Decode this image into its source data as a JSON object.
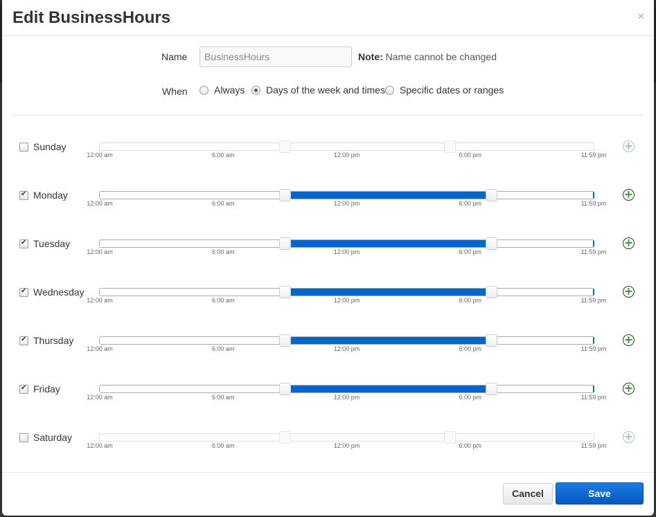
{
  "dialog": {
    "title": "Edit BusinessHours",
    "close_glyph": "×"
  },
  "name_field": {
    "label": "Name",
    "value": "BusinessHours",
    "note_label": "Note:",
    "note_text": "Name cannot be changed"
  },
  "when": {
    "label": "When",
    "options": [
      {
        "label": "Always",
        "checked": false
      },
      {
        "label": "Days of the week and times",
        "checked": true
      },
      {
        "label": "Specific dates or ranges",
        "checked": false
      }
    ]
  },
  "ticks": [
    "12:00 am",
    "6:00 am",
    "12:00 pm",
    "6:00 pm",
    "11:59 pm"
  ],
  "days": [
    {
      "label": "Sunday",
      "checked": false,
      "start_fraction": 0.375,
      "end_fraction": 0.708
    },
    {
      "label": "Monday",
      "checked": true,
      "start_fraction": 0.375,
      "end_fraction": 0.792
    },
    {
      "label": "Tuesday",
      "checked": true,
      "start_fraction": 0.375,
      "end_fraction": 0.792
    },
    {
      "label": "Wednesday",
      "checked": true,
      "start_fraction": 0.375,
      "end_fraction": 0.792
    },
    {
      "label": "Thursday",
      "checked": true,
      "start_fraction": 0.375,
      "end_fraction": 0.792
    },
    {
      "label": "Friday",
      "checked": true,
      "start_fraction": 0.375,
      "end_fraction": 0.792
    },
    {
      "label": "Saturday",
      "checked": false,
      "start_fraction": 0.375,
      "end_fraction": 0.708
    }
  ],
  "add_icon_glyph": "+",
  "footer": {
    "cancel_label": "Cancel",
    "save_label": "Save"
  },
  "colors": {
    "accent": "#0066cc",
    "add_icon": "#2a9d2a"
  }
}
